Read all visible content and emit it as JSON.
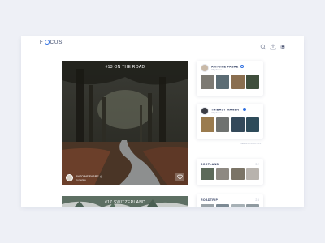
{
  "app": {
    "logo_prefix": "F",
    "logo_suffix": "CUS"
  },
  "colors": {
    "accent": "#2f6fe0",
    "text_dark": "#2d3a5e",
    "muted": "#a3a9ba",
    "background": "#eef0f6"
  },
  "toolbar": {
    "icons": [
      "search-icon",
      "upload-icon",
      "profile-icon"
    ]
  },
  "feed": {
    "main_post": {
      "title": "#13 ON THE ROAD",
      "author_name": "ANTOINE FABRE",
      "author_location": "Cornelica",
      "like_icon": "heart-icon"
    },
    "second_post": {
      "title": "#17 SWITZERLAND"
    }
  },
  "sidebar": {
    "profiles": [
      {
        "name": "ANTOINE FABRE",
        "subtitle": "34 photos",
        "thumb_colors": [
          "#7d7a73",
          "#5b6c74",
          "#8a6e4f",
          "#3f4e3c"
        ]
      },
      {
        "name": "THIBAUT MANENT",
        "subtitle": "21 photos",
        "thumb_colors": [
          "#9a7b4e",
          "#6f7270",
          "#34495a",
          "#2e4b5a"
        ]
      }
    ],
    "caption": "SEE ALL CREATORS",
    "albums": [
      {
        "name": "SCOTLAND",
        "count": "32",
        "thumb_colors": [
          "#5d6a5a",
          "#8e8982",
          "#7b7466",
          "#b8b3ad"
        ]
      },
      {
        "name": "ROADTRIP",
        "count": "24",
        "thumb_colors": [
          "#9aa3a8",
          "#7c8a94",
          "#a7b1b6",
          "#8f9aa0"
        ]
      }
    ]
  }
}
